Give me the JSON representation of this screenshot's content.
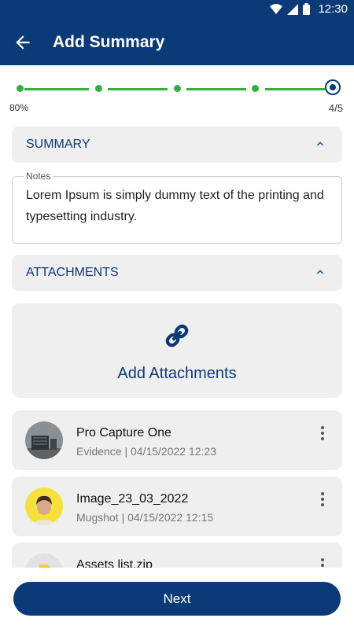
{
  "status_bar": {
    "time": "12:30"
  },
  "app_bar": {
    "title": "Add Summary"
  },
  "progress": {
    "left_label": "80%",
    "right_label": "4/5",
    "current_step": 5,
    "total_steps": 5,
    "accent": "#2eb23c"
  },
  "summary_section": {
    "label": "SUMMARY"
  },
  "notes": {
    "label": "Notes",
    "value": "Lorem Ipsum is simply dummy text of the printing and typesetting industry."
  },
  "attachments_section": {
    "label": "ATTACHMENTS"
  },
  "add_attachments": {
    "label": "Add Attachments",
    "icon": "link-icon"
  },
  "attachments": [
    {
      "name": "Pro Capture One",
      "meta": "Evidence | 04/15/2022  12:23",
      "thumb": "photo"
    },
    {
      "name": "Image_23_03_2022",
      "meta": "Mugshot | 04/15/2022  12:15",
      "thumb": "face"
    },
    {
      "name": "Assets list.zip",
      "meta": "",
      "thumb": "file"
    }
  ],
  "next_button": {
    "label": "Next"
  },
  "colors": {
    "brand": "#0b3a78",
    "card": "#efefef"
  }
}
